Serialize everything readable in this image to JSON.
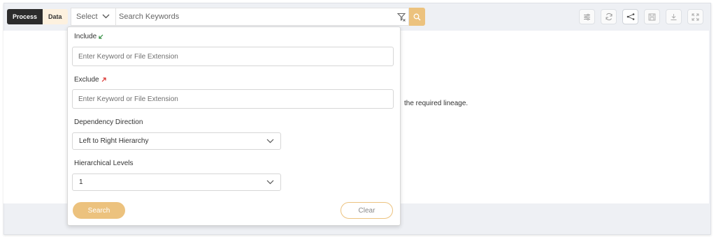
{
  "toolbar": {
    "tabs": [
      {
        "label": "Process",
        "active": true
      },
      {
        "label": "Data",
        "active": false
      }
    ],
    "select_label": "Select",
    "search_placeholder": "Search Keywords",
    "right_icons": [
      "settings-sliders-icon",
      "refresh-icon",
      "lineage-graph-icon",
      "save-icon",
      "download-icon",
      "fullscreen-icon"
    ]
  },
  "main": {
    "message_fragment": "the required lineage."
  },
  "panel": {
    "include_label": "Include",
    "include_placeholder": "Enter Keyword or File Extension",
    "exclude_label": "Exclude",
    "exclude_placeholder": "Enter Keyword or File Extension",
    "direction_label": "Dependency Direction",
    "direction_value": "Left to Right Hierarchy",
    "levels_label": "Hierarchical Levels",
    "levels_value": "1",
    "search_label": "Search",
    "clear_label": "Clear"
  },
  "colors": {
    "accent": "#ecc27e",
    "dark_tab": "#2c2c2c",
    "light_tab": "#fdf1df",
    "include_arrow": "#2e8b3e",
    "exclude_arrow": "#d9302c",
    "page_background": "#eef0f4"
  }
}
